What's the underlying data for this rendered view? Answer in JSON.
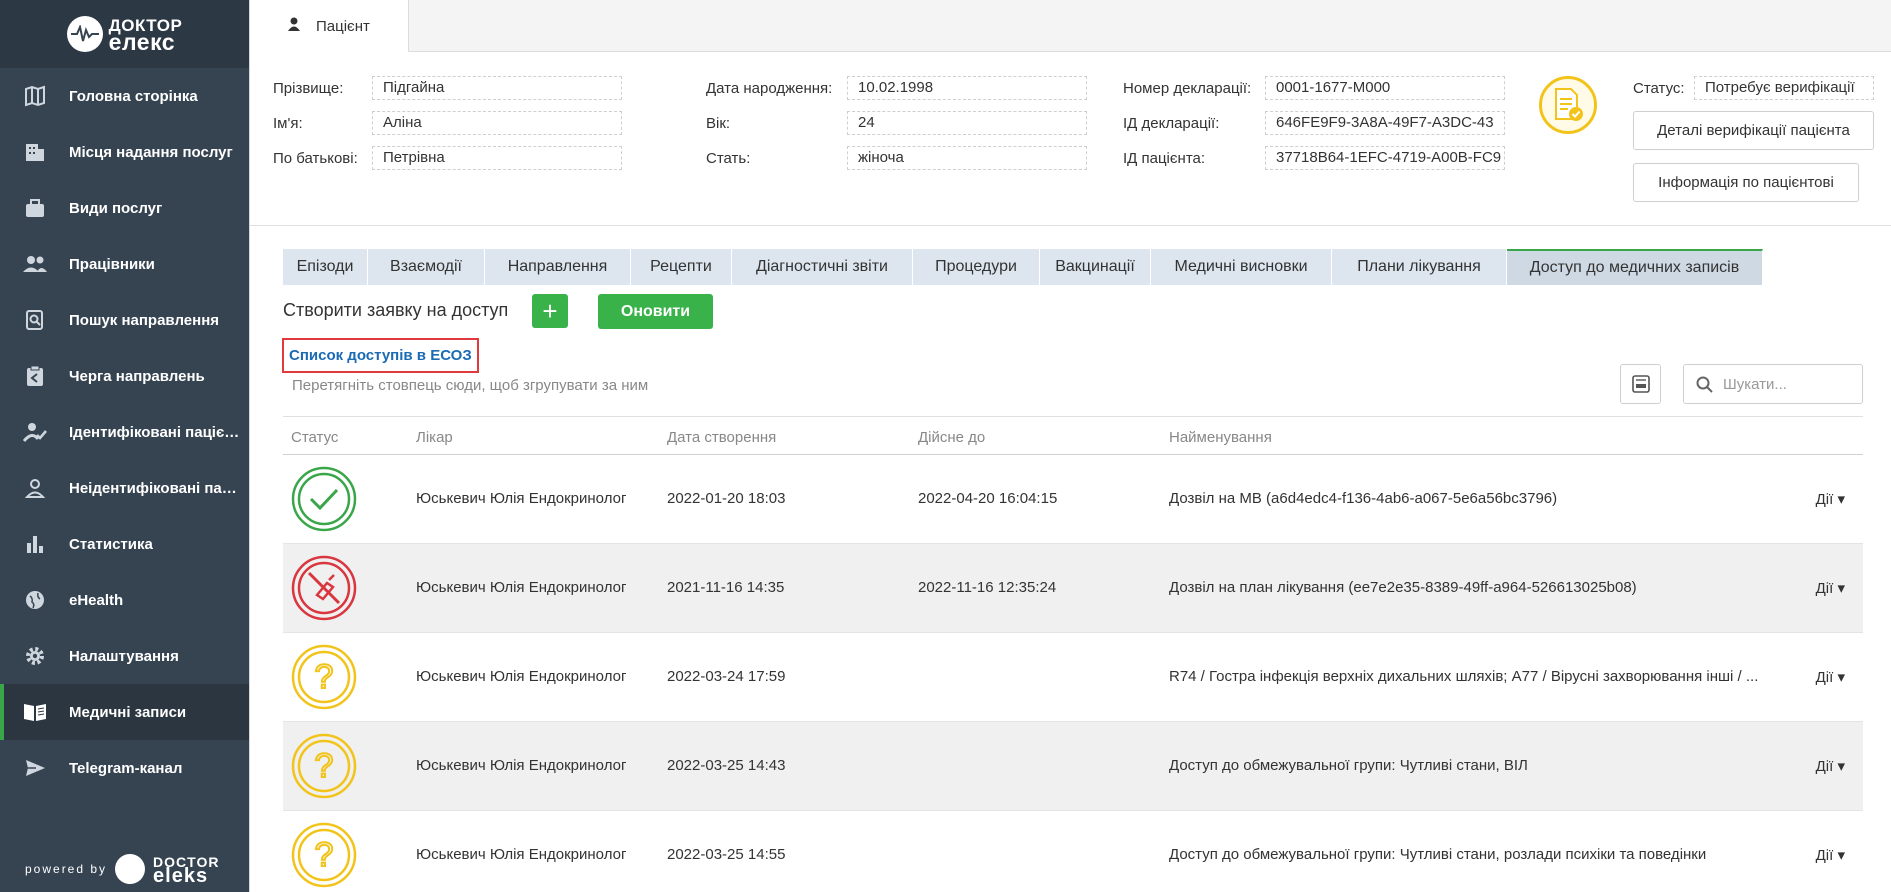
{
  "sidebar": {
    "logo": {
      "line1": "ДОКТОР",
      "line2": "елекс"
    },
    "items": [
      {
        "label": "Головна сторінка",
        "icon": "map-icon"
      },
      {
        "label": "Місця надання послуг",
        "icon": "building-icon"
      },
      {
        "label": "Види послуг",
        "icon": "briefcase-icon"
      },
      {
        "label": "Працівники",
        "icon": "people-icon"
      },
      {
        "label": "Пошук направлення",
        "icon": "search-document-icon"
      },
      {
        "label": "Черга направлень",
        "icon": "clipboard-queue-icon"
      },
      {
        "label": "Ідентифіковані пацієнти",
        "icon": "user-check-icon"
      },
      {
        "label": "Неідентифіковані пацієнти",
        "icon": "user-icon"
      },
      {
        "label": "Статистика",
        "icon": "bar-chart-icon"
      },
      {
        "label": "eHealth",
        "icon": "globe-icon"
      },
      {
        "label": "Налаштування",
        "icon": "gear-icon"
      },
      {
        "label": "Медичні записи",
        "icon": "book-icon",
        "active": true
      },
      {
        "label": "Telegram-канал",
        "icon": "send-icon"
      }
    ],
    "powered_by": "powered by",
    "powered_logo": {
      "line1": "DOCTOR",
      "line2": "eleks"
    }
  },
  "header": {
    "patient_tab": "Пацієнт"
  },
  "patient": {
    "surname_label": "Прізвище:",
    "surname": "Підгайна",
    "name_label": "Ім'я:",
    "name": "Аліна",
    "patronymic_label": "По батькові:",
    "patronymic": "Петрівна",
    "dob_label": "Дата народження:",
    "dob": "10.02.1998",
    "age_label": "Вік:",
    "age": "24",
    "sex_label": "Стать:",
    "sex": "жіноча",
    "decl_num_label": "Номер декларації:",
    "decl_num": "0001-1677-M000",
    "decl_id_label": "ІД декларації:",
    "decl_id": "646FE9F9-3A8A-49F7-A3DC-43",
    "patient_id_label": "ІД пацієнта:",
    "patient_id": "37718B64-1EFC-4719-A00B-FC9",
    "status_label": "Статус:",
    "status": "Потребує верифікації",
    "verify_details_button": "Деталі верифікації пацієнта",
    "patient_info_button": "Інформація по пацієнтові"
  },
  "tabs": [
    {
      "label": "Епізоди"
    },
    {
      "label": "Взаємодії"
    },
    {
      "label": "Направлення"
    },
    {
      "label": "Рецепти"
    },
    {
      "label": "Діагностичні звіти"
    },
    {
      "label": "Процедури"
    },
    {
      "label": "Вакцинації"
    },
    {
      "label": "Медичні висновки"
    },
    {
      "label": "Плани лікування"
    },
    {
      "label": "Доступ до медичних записів",
      "active": true
    }
  ],
  "toolbar": {
    "create_label": "Створити заявку на доступ",
    "plus": "+",
    "refresh_label": "Оновити",
    "ecoz_link": "Список доступів в ЕСОЗ",
    "group_hint": "Перетягніть стовпець сюди, щоб згрупувати за ним",
    "search_placeholder": "Шукати..."
  },
  "grid": {
    "columns": [
      "Статус",
      "Лікар",
      "Дата створення",
      "Дійсне до",
      "Найменування"
    ],
    "actions_label": "Дії",
    "rows": [
      {
        "status": "approved",
        "doctor": "Юськевич Юлія Ендокринолог",
        "created": "2022-01-20 18:03",
        "valid_until": "2022-04-20 16:04:15",
        "name": "Дозвіл на МВ (a6d4edc4-f136-4ab6-a067-5e6a56bc3796)"
      },
      {
        "status": "revoked",
        "doctor": "Юськевич Юлія Ендокринолог",
        "created": "2021-11-16 14:35",
        "valid_until": "2022-11-16 12:35:24",
        "name": "Дозвіл на план лікування (ee7e2e35-8389-49ff-a964-526613025b08)"
      },
      {
        "status": "pending",
        "doctor": "Юськевич Юлія Ендокринолог",
        "created": "2022-03-24 17:59",
        "valid_until": "",
        "name": "R74 / Гостра інфекція верхніх дихальних шляхів; A77 / Вірусні захворювання інші / ..."
      },
      {
        "status": "pending",
        "doctor": "Юськевич Юлія Ендокринолог",
        "created": "2022-03-25 14:43",
        "valid_until": "",
        "name": "Доступ до обмежувальної групи: Чутливі стани, ВІЛ"
      },
      {
        "status": "pending",
        "doctor": "Юськевич Юлія Ендокринолог",
        "created": "2022-03-25 14:55",
        "valid_until": "",
        "name": "Доступ до обмежувальної групи: Чутливі стани, розлади психіки та поведінки"
      }
    ]
  },
  "colors": {
    "sidebar": "#364452",
    "accent_green": "#3ab24a",
    "link_blue": "#1a6ab4",
    "highlight_red": "#e0393e",
    "status_ok": "#3aa64a",
    "status_revoked": "#d9363e",
    "status_pending": "#f2c41b"
  }
}
